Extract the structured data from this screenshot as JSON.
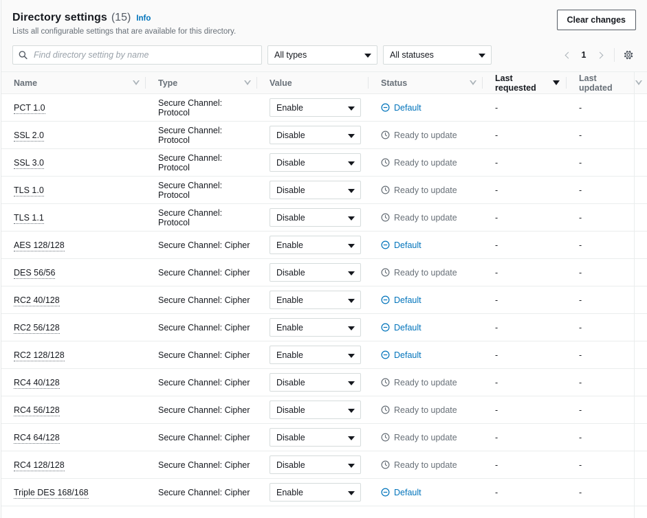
{
  "header": {
    "title": "Directory settings",
    "count": "(15)",
    "info_label": "Info",
    "subtitle": "Lists all configurable settings that are available for this directory.",
    "clear_changes_label": "Clear changes"
  },
  "filters": {
    "search_placeholder": "Find directory setting by name",
    "search_value": "",
    "search_icon": "search-icon",
    "type_filter": "All types",
    "status_filter": "All statuses",
    "pagination": {
      "prev_icon": "chevron-left-icon",
      "page": "1",
      "next_icon": "chevron-right-icon"
    },
    "preferences_icon": "gear-icon"
  },
  "table": {
    "columns": [
      {
        "label": "Name",
        "sort": "hollow"
      },
      {
        "label": "Type",
        "sort": "hollow"
      },
      {
        "label": "Value",
        "sort": "none"
      },
      {
        "label": "Status",
        "sort": "hollow"
      },
      {
        "label": "Last requested",
        "sort": "solid"
      },
      {
        "label": "Last updated",
        "sort": "hollow"
      }
    ],
    "rows": [
      {
        "name": "PCT 1.0",
        "type": "Secure Channel: Protocol",
        "value": "Enable",
        "status": "Default",
        "status_icon": "circle-minus-icon",
        "last_requested": "-",
        "last_updated": "-"
      },
      {
        "name": "SSL 2.0",
        "type": "Secure Channel: Protocol",
        "value": "Disable",
        "status": "Ready to update",
        "status_icon": "clock-icon",
        "last_requested": "-",
        "last_updated": "-"
      },
      {
        "name": "SSL 3.0",
        "type": "Secure Channel: Protocol",
        "value": "Disable",
        "status": "Ready to update",
        "status_icon": "clock-icon",
        "last_requested": "-",
        "last_updated": "-"
      },
      {
        "name": "TLS 1.0",
        "type": "Secure Channel: Protocol",
        "value": "Disable",
        "status": "Ready to update",
        "status_icon": "clock-icon",
        "last_requested": "-",
        "last_updated": "-"
      },
      {
        "name": "TLS 1.1",
        "type": "Secure Channel: Protocol",
        "value": "Disable",
        "status": "Ready to update",
        "status_icon": "clock-icon",
        "last_requested": "-",
        "last_updated": "-"
      },
      {
        "name": "AES 128/128",
        "type": "Secure Channel: Cipher",
        "value": "Enable",
        "status": "Default",
        "status_icon": "circle-minus-icon",
        "last_requested": "-",
        "last_updated": "-"
      },
      {
        "name": "DES 56/56",
        "type": "Secure Channel: Cipher",
        "value": "Disable",
        "status": "Ready to update",
        "status_icon": "clock-icon",
        "last_requested": "-",
        "last_updated": "-"
      },
      {
        "name": "RC2 40/128",
        "type": "Secure Channel: Cipher",
        "value": "Enable",
        "status": "Default",
        "status_icon": "circle-minus-icon",
        "last_requested": "-",
        "last_updated": "-"
      },
      {
        "name": "RC2 56/128",
        "type": "Secure Channel: Cipher",
        "value": "Enable",
        "status": "Default",
        "status_icon": "circle-minus-icon",
        "last_requested": "-",
        "last_updated": "-"
      },
      {
        "name": "RC2 128/128",
        "type": "Secure Channel: Cipher",
        "value": "Enable",
        "status": "Default",
        "status_icon": "circle-minus-icon",
        "last_requested": "-",
        "last_updated": "-"
      },
      {
        "name": "RC4 40/128",
        "type": "Secure Channel: Cipher",
        "value": "Disable",
        "status": "Ready to update",
        "status_icon": "clock-icon",
        "last_requested": "-",
        "last_updated": "-"
      },
      {
        "name": "RC4 56/128",
        "type": "Secure Channel: Cipher",
        "value": "Disable",
        "status": "Ready to update",
        "status_icon": "clock-icon",
        "last_requested": "-",
        "last_updated": "-"
      },
      {
        "name": "RC4 64/128",
        "type": "Secure Channel: Cipher",
        "value": "Disable",
        "status": "Ready to update",
        "status_icon": "clock-icon",
        "last_requested": "-",
        "last_updated": "-"
      },
      {
        "name": "RC4 128/128",
        "type": "Secure Channel: Cipher",
        "value": "Disable",
        "status": "Ready to update",
        "status_icon": "clock-icon",
        "last_requested": "-",
        "last_updated": "-"
      },
      {
        "name": "Triple DES 168/168",
        "type": "Secure Channel: Cipher",
        "value": "Enable",
        "status": "Default",
        "status_icon": "circle-minus-icon",
        "last_requested": "-",
        "last_updated": "-"
      }
    ]
  },
  "colors": {
    "link_blue": "#0073bb",
    "status_default": "#0073bb",
    "status_ready": "#687078",
    "header_bg": "#fafafa",
    "border": "#eaeded",
    "text": "#16191f"
  }
}
